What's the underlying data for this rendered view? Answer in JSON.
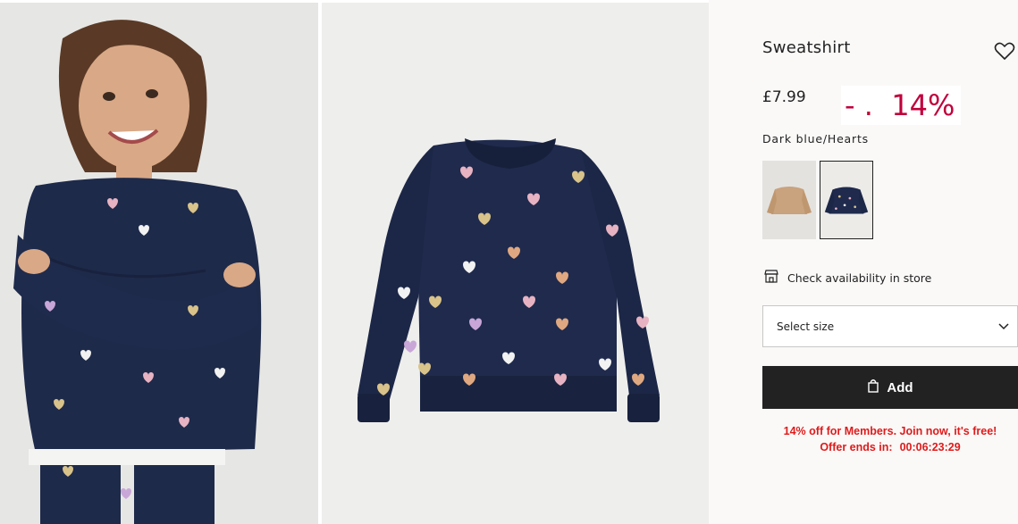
{
  "product": {
    "title": "Sweatshirt",
    "price": "£7.99",
    "discount_badge": "- .  14%",
    "color_name": "Dark blue/Hearts"
  },
  "images": {
    "model_photo": "child-wearing-heart-sweatshirt",
    "product_photo": "navy-heart-sweatshirt-flatlay"
  },
  "swatches": [
    {
      "name": "beige",
      "color": "#c9a27e",
      "selected": false
    },
    {
      "name": "dark-blue-hearts",
      "color": "#1f2a4d",
      "selected": true
    }
  ],
  "store": {
    "label": "Check availability in store",
    "icon": "store-icon"
  },
  "size_select": {
    "label": "Select size",
    "icon": "chevron-down-icon"
  },
  "add_button": {
    "label": "Add",
    "icon": "bag-icon"
  },
  "promo": {
    "line1": "14% off for Members. Join now, it's free!",
    "offer_label": "Offer ends in:",
    "countdown": "00:06:23:29"
  },
  "colors": {
    "navy": "#1e2a4a",
    "discount_red": "#c0003b",
    "promo_red": "#e01a1a",
    "button_black": "#222222"
  },
  "icons": {
    "favorite": "heart-outline-icon"
  }
}
